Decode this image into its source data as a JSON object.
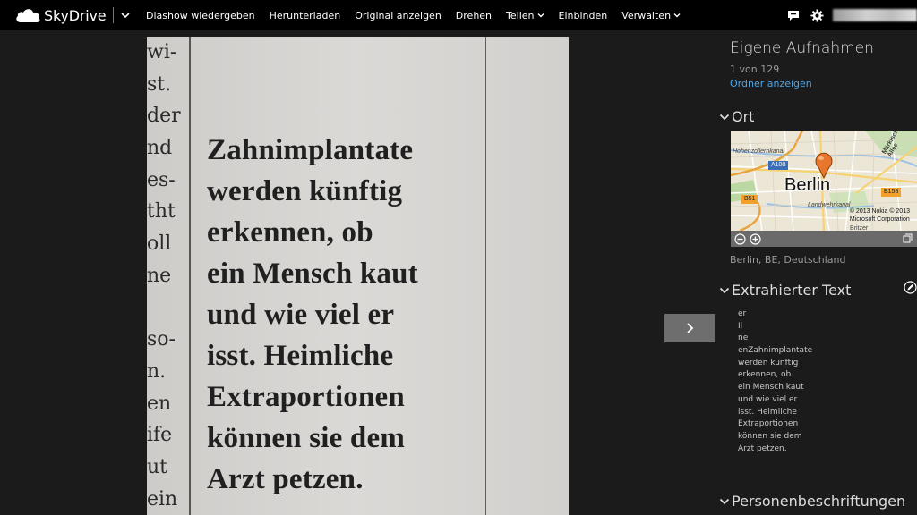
{
  "app": {
    "brand": "SkyDrive"
  },
  "toolbar": {
    "items": [
      {
        "label": "Diashow wiedergeben",
        "has_dropdown": false
      },
      {
        "label": "Herunterladen",
        "has_dropdown": false
      },
      {
        "label": "Original anzeigen",
        "has_dropdown": false
      },
      {
        "label": "Drehen",
        "has_dropdown": false
      },
      {
        "label": "Teilen",
        "has_dropdown": true
      },
      {
        "label": "Einbinden",
        "has_dropdown": false
      },
      {
        "label": "Verwalten",
        "has_dropdown": true
      }
    ]
  },
  "photo": {
    "fragment_lines": [
      "wi-",
      "st.",
      "der",
      "nd",
      "es-",
      "tht",
      "oll",
      "ne",
      "",
      "so-",
      "n.",
      "en",
      "ife",
      "ut",
      "ein"
    ],
    "quote_lines": [
      "Zahnimplantate",
      "werden künftig",
      "erkennen, ob",
      "ein Mensch kaut",
      "und wie viel er",
      "isst. Heimliche",
      "Extraportionen",
      "können sie dem",
      "Arzt petzen."
    ]
  },
  "panel": {
    "album_title": "Eigene Aufnahmen",
    "count": "1 von 129",
    "folder_link": "Ordner anzeigen",
    "location_section": "Ort",
    "map": {
      "city": "Berlin",
      "labels": [
        "Hohenzollernkanal",
        "Landwehrkanal",
        "Märkische Allee",
        "Britzer"
      ],
      "road_shields": [
        "A100",
        "B51",
        "B158"
      ],
      "copyright_lines": [
        "© 2013 Nokia",
        "© 2013",
        "Microsoft Corporation"
      ]
    },
    "location_text": "Berlin, BE, Deutschland",
    "extracted_section": "Extrahierter Text",
    "extracted_lines": [
      "er",
      "Il",
      "ne",
      "enZahnimplantate",
      "werden künftig",
      "erkennen, ob",
      "ein Mensch kaut",
      "und wie viel er",
      "isst. Heimliche",
      "Extraportionen",
      "können sie dem",
      "Arzt petzen."
    ],
    "people_section": "Personenbeschriftungen"
  },
  "colors": {
    "background": "#1b1b1b",
    "topbar": "#000000",
    "link": "#4aa6e8",
    "next_button": "#6e6e6e"
  }
}
